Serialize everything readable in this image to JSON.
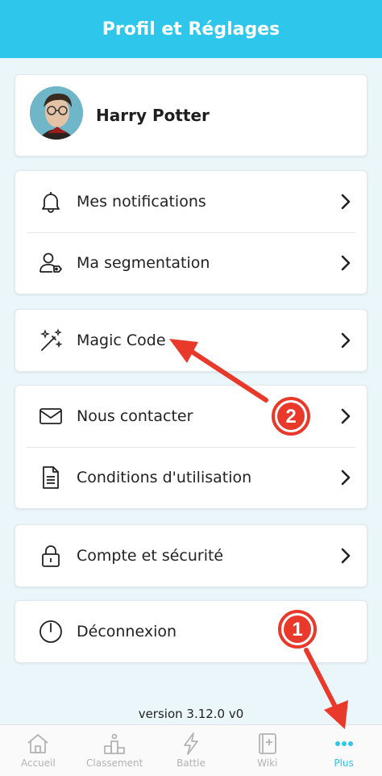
{
  "header": {
    "title": "Profil et Réglages"
  },
  "profile": {
    "name": "Harry Potter"
  },
  "groups": [
    {
      "items": [
        {
          "label": "Mes notifications",
          "icon": "bell-icon"
        },
        {
          "label": "Ma segmentation",
          "icon": "user-tag-icon"
        }
      ]
    },
    {
      "items": [
        {
          "label": "Magic Code",
          "icon": "magic-wand-icon"
        }
      ]
    },
    {
      "items": [
        {
          "label": "Nous contacter",
          "icon": "envelope-icon"
        },
        {
          "label": "Conditions d'utilisation",
          "icon": "document-icon"
        }
      ]
    },
    {
      "items": [
        {
          "label": "Compte et sécurité",
          "icon": "lock-icon"
        }
      ]
    },
    {
      "items": [
        {
          "label": "Déconnexion",
          "icon": "power-icon"
        }
      ]
    }
  ],
  "version": "version 3.12.0 v0",
  "tabs": [
    {
      "label": "Accueil",
      "icon": "home-icon"
    },
    {
      "label": "Classement",
      "icon": "podium-icon"
    },
    {
      "label": "Battle",
      "icon": "lightning-icon"
    },
    {
      "label": "Wiki",
      "icon": "book-icon"
    },
    {
      "label": "Plus",
      "icon": "more-dots-icon",
      "active": true
    }
  ],
  "annotations": {
    "marker_1": "1",
    "marker_2": "2"
  },
  "colors": {
    "accent": "#2ec6ea",
    "annotation": "#e8392b"
  }
}
